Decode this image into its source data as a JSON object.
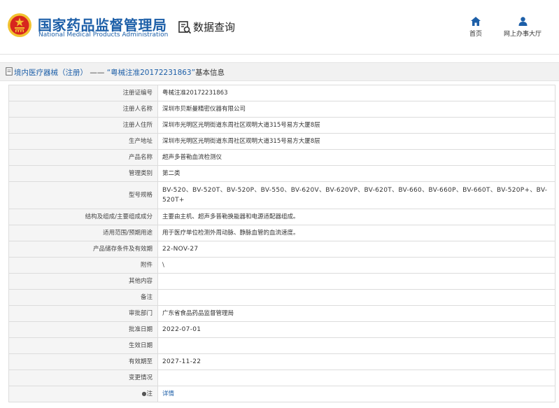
{
  "header": {
    "brand_cn": "国家药品监督管理局",
    "brand_en": "National Medical Products Administration",
    "page_title": "数据查询",
    "nav": [
      {
        "label": "首页",
        "icon": "home-icon"
      },
      {
        "label": "网上办事大厅",
        "icon": "user-icon"
      }
    ]
  },
  "section": {
    "crumb": "境内医疗器械（注册）",
    "separator": " —— ",
    "reg_no": "“粤械注准20172231863”",
    "suffix": "基本信息"
  },
  "rows": [
    {
      "label": "注册证编号",
      "value": "粤械注准20172231863"
    },
    {
      "label": "注册人名称",
      "value": "深圳市贝斯曼精密仪器有限公司"
    },
    {
      "label": "注册人住所",
      "value": "深圳市光明区光明街道东周社区观明大道315号易方大厦8层"
    },
    {
      "label": "生产地址",
      "value": "深圳市光明区光明街道东周社区观明大道315号易方大厦8层"
    },
    {
      "label": "产品名称",
      "value": "超声多普勒血流检测仪"
    },
    {
      "label": "管理类别",
      "value": "第二类"
    },
    {
      "label": "型号规格",
      "value": "BV-520、BV-520T、BV-520P、BV-550、BV-620V、BV-620VP、BV-620T、BV-660、BV-660P、BV-660T、BV-520P+、BV-520T+"
    },
    {
      "label": "结构及组成/主要组成成分",
      "value": "主要由主机、超声多普勒换能器和电源适配器组成。"
    },
    {
      "label": "适用范围/预期用途",
      "value": "用于医疗单位检测外周动脉、静脉血管的血流速度。"
    },
    {
      "label": "产品储存条件及有效期",
      "value": "22-NOV-27"
    },
    {
      "label": "附件",
      "value": "\\"
    },
    {
      "label": "其他内容",
      "value": ""
    },
    {
      "label": "备注",
      "value": ""
    },
    {
      "label": "审批部门",
      "value": "广东省食品药品监督管理局"
    },
    {
      "label": "批准日期",
      "value": "2022-07-01"
    },
    {
      "label": "生效日期",
      "value": ""
    },
    {
      "label": "有效期至",
      "value": "2027-11-22"
    },
    {
      "label": "变更情况",
      "value": ""
    },
    {
      "label": "注",
      "value": "详情"
    }
  ],
  "colors": {
    "brand_blue": "#1d5fa8",
    "emblem_red": "#d7261e",
    "emblem_gold": "#f2c230"
  }
}
